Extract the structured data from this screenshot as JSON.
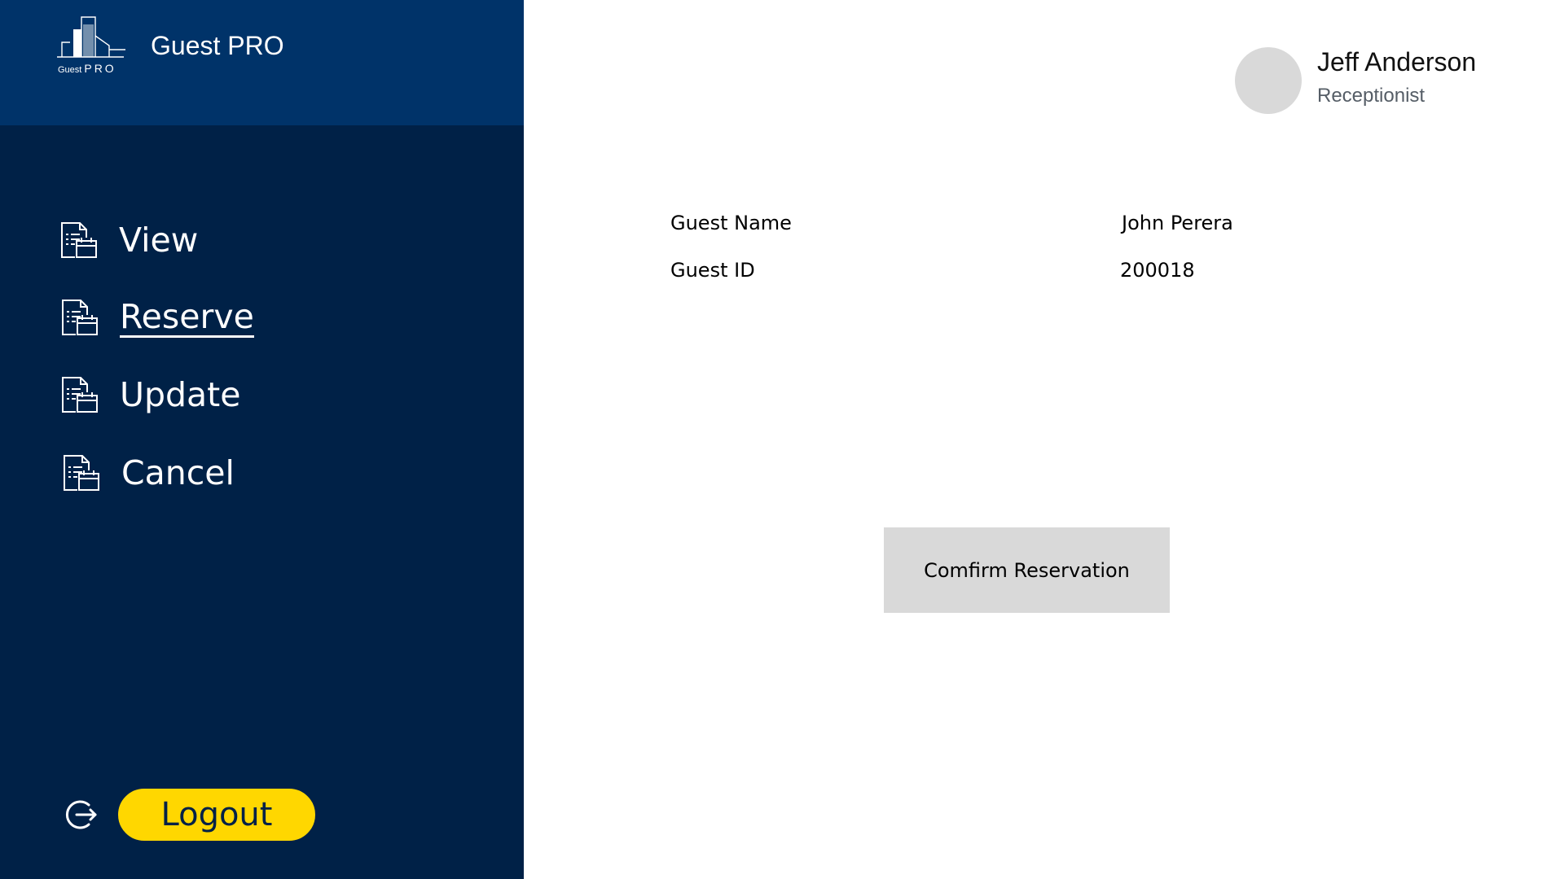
{
  "app": {
    "title": "Guest PRO",
    "logo_text_small": "Guest",
    "logo_text_big": "PRO"
  },
  "sidebar": {
    "items": [
      {
        "label": "View",
        "icon": "document-calendar-icon",
        "active": false
      },
      {
        "label": "Reserve",
        "icon": "document-calendar-icon",
        "active": true
      },
      {
        "label": "Update",
        "icon": "document-calendar-icon",
        "active": false
      },
      {
        "label": "Cancel",
        "icon": "document-calendar-icon",
        "active": false
      }
    ],
    "logout_label": "Logout",
    "logout_icon": "logout-icon"
  },
  "user": {
    "name": "Jeff Anderson",
    "role": "Receptionist"
  },
  "guest": {
    "name_label": "Guest Name",
    "name_value": "John Perera",
    "id_label": "Guest ID",
    "id_value": "200018"
  },
  "actions": {
    "confirm_label": "Comfirm Reservation"
  },
  "colors": {
    "sidebar_bg": "#002147",
    "header_bg": "#003369",
    "logout_bg": "#ffd700",
    "button_bg": "#d9d9d9",
    "avatar_bg": "#d9d9d9"
  }
}
